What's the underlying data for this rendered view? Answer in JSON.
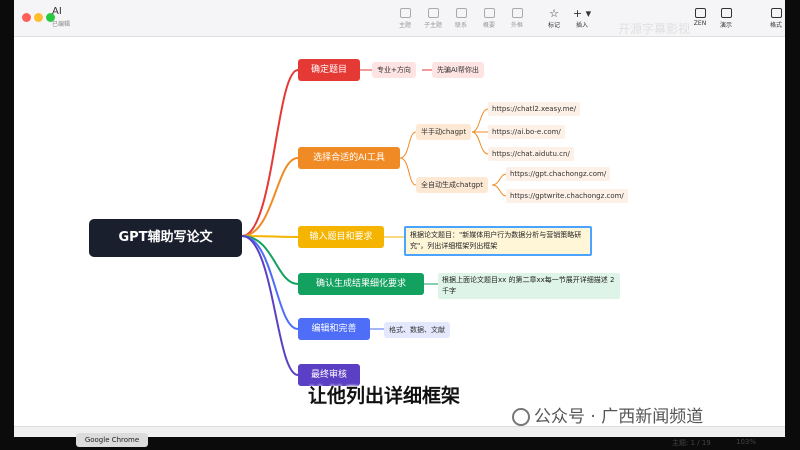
{
  "app": {
    "title": "AI",
    "subtitle": "已编辑"
  },
  "toolbar": {
    "buttons": [
      {
        "label": "主题"
      },
      {
        "label": "子主题"
      },
      {
        "label": "联系"
      },
      {
        "label": "概要"
      },
      {
        "label": "外框"
      },
      {
        "label": "标记"
      },
      {
        "label": "插入"
      },
      {
        "label": "ZEN"
      },
      {
        "label": "演示"
      },
      {
        "label": "格式"
      }
    ]
  },
  "watermark_top": "开源字幕影视",
  "mindmap": {
    "root": "GPT辅助写论文",
    "branches": [
      {
        "label": "确定题目",
        "color": "#e53935"
      },
      {
        "label": "选择合适的AI工具",
        "color": "#f08a24"
      },
      {
        "label": "输入题目和要求",
        "color": "#f4b400"
      },
      {
        "label": "确认生成结果细化要求",
        "color": "#12a15f"
      },
      {
        "label": "编辑和完善",
        "color": "#4f6ef7"
      },
      {
        "label": "最终审核",
        "color": "#5b3fc4"
      }
    ],
    "topic_sub1": "专业+方向",
    "topic_sub2": "先骗AI帮你出",
    "tools_manual": "半手动chagpt",
    "tools_auto": "全自动生成chatgpt",
    "links_manual": [
      "https://chatl2.xeasy.me/",
      "https://ai.bo-e.com/",
      "https://chat.aidutu.cn/"
    ],
    "links_auto": [
      "https://gpt.chachongz.com/",
      "https://gptwrite.chachongz.com/"
    ],
    "input_text": "根据论文题目：\"新媒体用户行为数据分析与营销策略研究\"，列出详细框架列出框架",
    "refine_text": "根据上面论文题目xx 的第二章xx每一节展开详细描述 2千字",
    "edit_text": "格式、数据、文献"
  },
  "caption": "让他列出详细框架",
  "watermark": "公众号 · 广西新闻频道",
  "dock": {
    "app": "Google Chrome"
  },
  "status": {
    "topics": "主题: 1 / 19",
    "zoom": "103%"
  },
  "colors": {
    "root_bg": "#1a1f2e",
    "canvas_bg": "#ffffff"
  }
}
